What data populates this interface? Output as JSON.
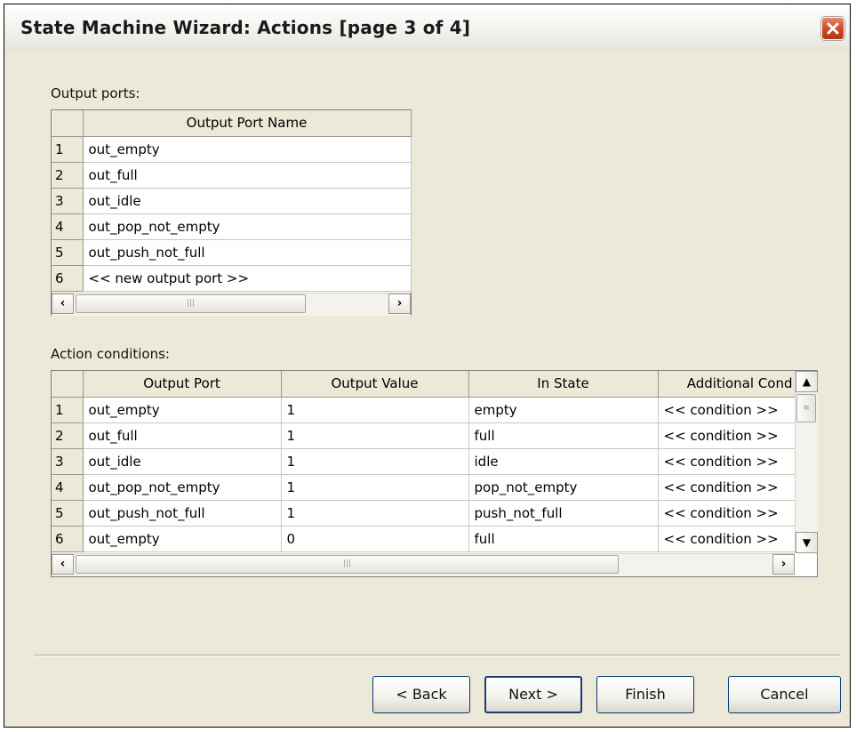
{
  "window": {
    "title": "State Machine Wizard: Actions [page 3  of 4]"
  },
  "output_ports": {
    "label": "Output ports:",
    "column_header": "Output Port Name",
    "rows": [
      {
        "num": "1",
        "name": "out_empty"
      },
      {
        "num": "2",
        "name": "out_full"
      },
      {
        "num": "3",
        "name": "out_idle"
      },
      {
        "num": "4",
        "name": "out_pop_not_empty"
      },
      {
        "num": "5",
        "name": "out_push_not_full"
      },
      {
        "num": "6",
        "name": "<< new output port >>"
      }
    ]
  },
  "action_conditions": {
    "label": "Action conditions:",
    "columns": [
      "Output Port",
      "Output Value",
      "In State",
      "Additional Cond"
    ],
    "rows": [
      {
        "num": "1",
        "port": "out_empty",
        "value": "1",
        "state": "empty",
        "cond": "<< condition >>"
      },
      {
        "num": "2",
        "port": "out_full",
        "value": "1",
        "state": "full",
        "cond": "<< condition >>"
      },
      {
        "num": "3",
        "port": "out_idle",
        "value": "1",
        "state": "idle",
        "cond": "<< condition >>"
      },
      {
        "num": "4",
        "port": "out_pop_not_empty",
        "value": "1",
        "state": "pop_not_empty",
        "cond": "<< condition >>"
      },
      {
        "num": "5",
        "port": "out_push_not_full",
        "value": "1",
        "state": "push_not_full",
        "cond": "<< condition >>"
      },
      {
        "num": "6",
        "port": "out_empty",
        "value": "0",
        "state": "full",
        "cond": "<< condition >>"
      }
    ]
  },
  "buttons": {
    "back": "< Back",
    "next": "Next >",
    "finish": "Finish",
    "cancel": "Cancel"
  },
  "icons": {
    "close": "close-icon",
    "scroll_left": "arrow-left-icon",
    "scroll_right": "arrow-right-icon",
    "scroll_up": "arrow-up-icon",
    "scroll_down": "arrow-down-icon"
  },
  "colors": {
    "dialog_bg": "#ece9d8",
    "close_button": "#d24b2b"
  }
}
